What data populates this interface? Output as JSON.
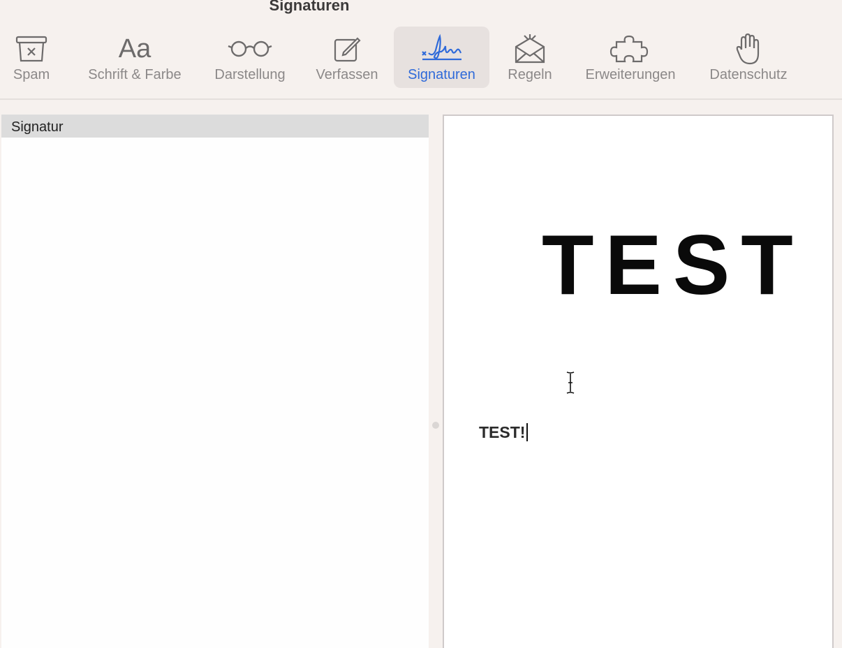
{
  "window": {
    "title": "Signaturen"
  },
  "toolbar": {
    "items": [
      {
        "label": "Spam",
        "icon": "junk-bin-icon",
        "selected": false
      },
      {
        "label": "Schrift & Farbe",
        "icon": "font-aa-icon",
        "selected": false
      },
      {
        "label": "Darstellung",
        "icon": "glasses-icon",
        "selected": false
      },
      {
        "label": "Verfassen",
        "icon": "compose-icon",
        "selected": false
      },
      {
        "label": "Signaturen",
        "icon": "signature-icon",
        "selected": true
      },
      {
        "label": "Regeln",
        "icon": "rules-envelope-icon",
        "selected": false
      },
      {
        "label": "Erweiterungen",
        "icon": "puzzle-icon",
        "selected": false
      },
      {
        "label": "Datenschutz",
        "icon": "hand-icon",
        "selected": false
      }
    ],
    "accent_color": "#2f6ad9"
  },
  "signature_list": {
    "header": "Signatur"
  },
  "editor": {
    "logo_text": "TEST",
    "signature_text": "TEST!"
  }
}
